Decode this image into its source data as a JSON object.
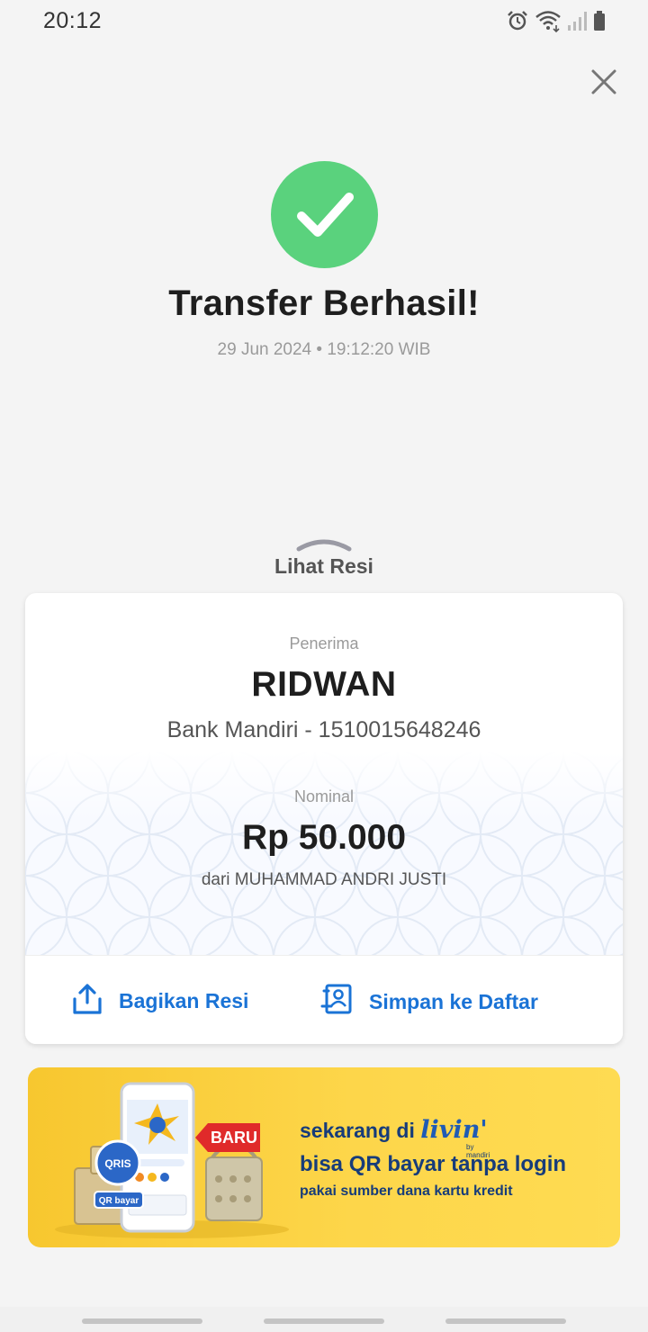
{
  "status_bar": {
    "time": "20:12",
    "icons": [
      "alarm-icon",
      "wifi-icon",
      "signal-icon",
      "battery-icon"
    ]
  },
  "close_icon": "close-icon",
  "result": {
    "title": "Transfer Berhasil!",
    "datetime": "29 Jun 2024 • 19:12:20 WIB",
    "icon": "check-circle-icon"
  },
  "receipt_toggle": {
    "label": "Lihat Resi",
    "icon": "chevron-up-icon"
  },
  "receipt": {
    "receiver_label": "Penerima",
    "receiver_name": "RIDWAN",
    "receiver_bank": "Bank Mandiri - 1510015648246",
    "amount_label": "Nominal",
    "amount": "Rp 50.000",
    "sender": "dari MUHAMMAD ANDRI JUSTI"
  },
  "actions": {
    "share_label": "Bagikan Resi",
    "save_label": "Simpan ke Daftar"
  },
  "banner": {
    "line1_prefix": "sekarang di",
    "line1_brand": "livin'",
    "line1_brand_sub": "by mandiri",
    "line2": "bisa QR bayar tanpa login",
    "line3": "pakai sumber dana kartu kredit",
    "badge": "BARU",
    "qris_label": "QRIS",
    "qr_bayar_label": "QR bayar"
  },
  "colors": {
    "success": "#5ad27d",
    "accent": "#1a73d6",
    "banner_bg": "#fdd64a",
    "banner_text": "#173c7a",
    "badge": "#e02a2a"
  }
}
